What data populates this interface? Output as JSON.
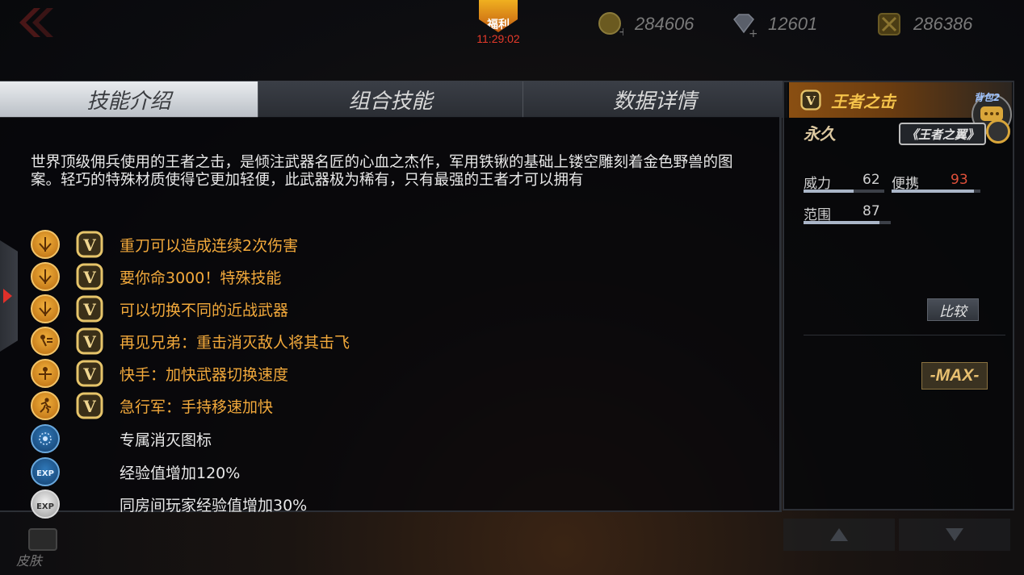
{
  "topbar": {
    "welfare_label": "福利",
    "welfare_timer": "11:29:02",
    "currencies": [
      {
        "icon": "gold-coin-icon",
        "value": "284606"
      },
      {
        "icon": "diamond-icon",
        "value": "12601"
      },
      {
        "icon": "honor-token-icon",
        "value": "286386"
      }
    ]
  },
  "tabs": [
    {
      "label": "技能介绍",
      "active": true
    },
    {
      "label": "组合技能",
      "active": false
    },
    {
      "label": "数据详情",
      "active": false
    }
  ],
  "description": "世界顶级佣兵使用的王者之击，是倾注武器名匠的心血之杰作，军用铁锹的基础上镂空雕刻着金色野兽的图案。轻巧的特殊材质使得它更加轻便，此武器极为稀有，只有最强的王者才可以拥有",
  "skills": [
    {
      "icon": "blade-icon",
      "v_badge": true,
      "text": "重刀可以造成连续2次伤害"
    },
    {
      "icon": "blade-icon",
      "v_badge": true,
      "text": "要你命3000！特殊技能"
    },
    {
      "icon": "blade-icon",
      "v_badge": true,
      "text": "可以切换不同的近战武器"
    },
    {
      "icon": "knockback-icon",
      "v_badge": true,
      "text": "再见兄弟：重击消灭敌人将其击飞"
    },
    {
      "icon": "quick-hand-icon",
      "v_badge": true,
      "text": "快手：加快武器切换速度"
    },
    {
      "icon": "running-man-icon",
      "v_badge": true,
      "text": "急行军：手持移速加快"
    },
    {
      "icon": "kill-emblem-icon",
      "v_badge": false,
      "text": "专属消灭图标"
    },
    {
      "icon": "exp-boost-icon",
      "v_badge": false,
      "text": "经验值增加120%"
    },
    {
      "icon": "room-exp-icon",
      "v_badge": false,
      "text": "同房间玩家经验值增加30%"
    }
  ],
  "weapon": {
    "name": "王者之击",
    "duration": "永久",
    "series_logo": "《王者之翼》",
    "chat_label": "背包2",
    "stats": [
      {
        "label": "威力",
        "value": "62",
        "fraction": 0.62,
        "highlight": false
      },
      {
        "label": "便携",
        "value": "93",
        "fraction": 0.93,
        "highlight": true
      },
      {
        "label": "范围",
        "value": "87",
        "fraction": 0.87,
        "highlight": false
      }
    ],
    "compare_label": "比较",
    "level_badge": "-MAX-"
  },
  "bottom": {
    "skin_label": "皮肤"
  },
  "colors": {
    "accent_orange": "#f2a93b",
    "highlight_red": "#e0503a",
    "timer_red": "#e53a2a"
  }
}
